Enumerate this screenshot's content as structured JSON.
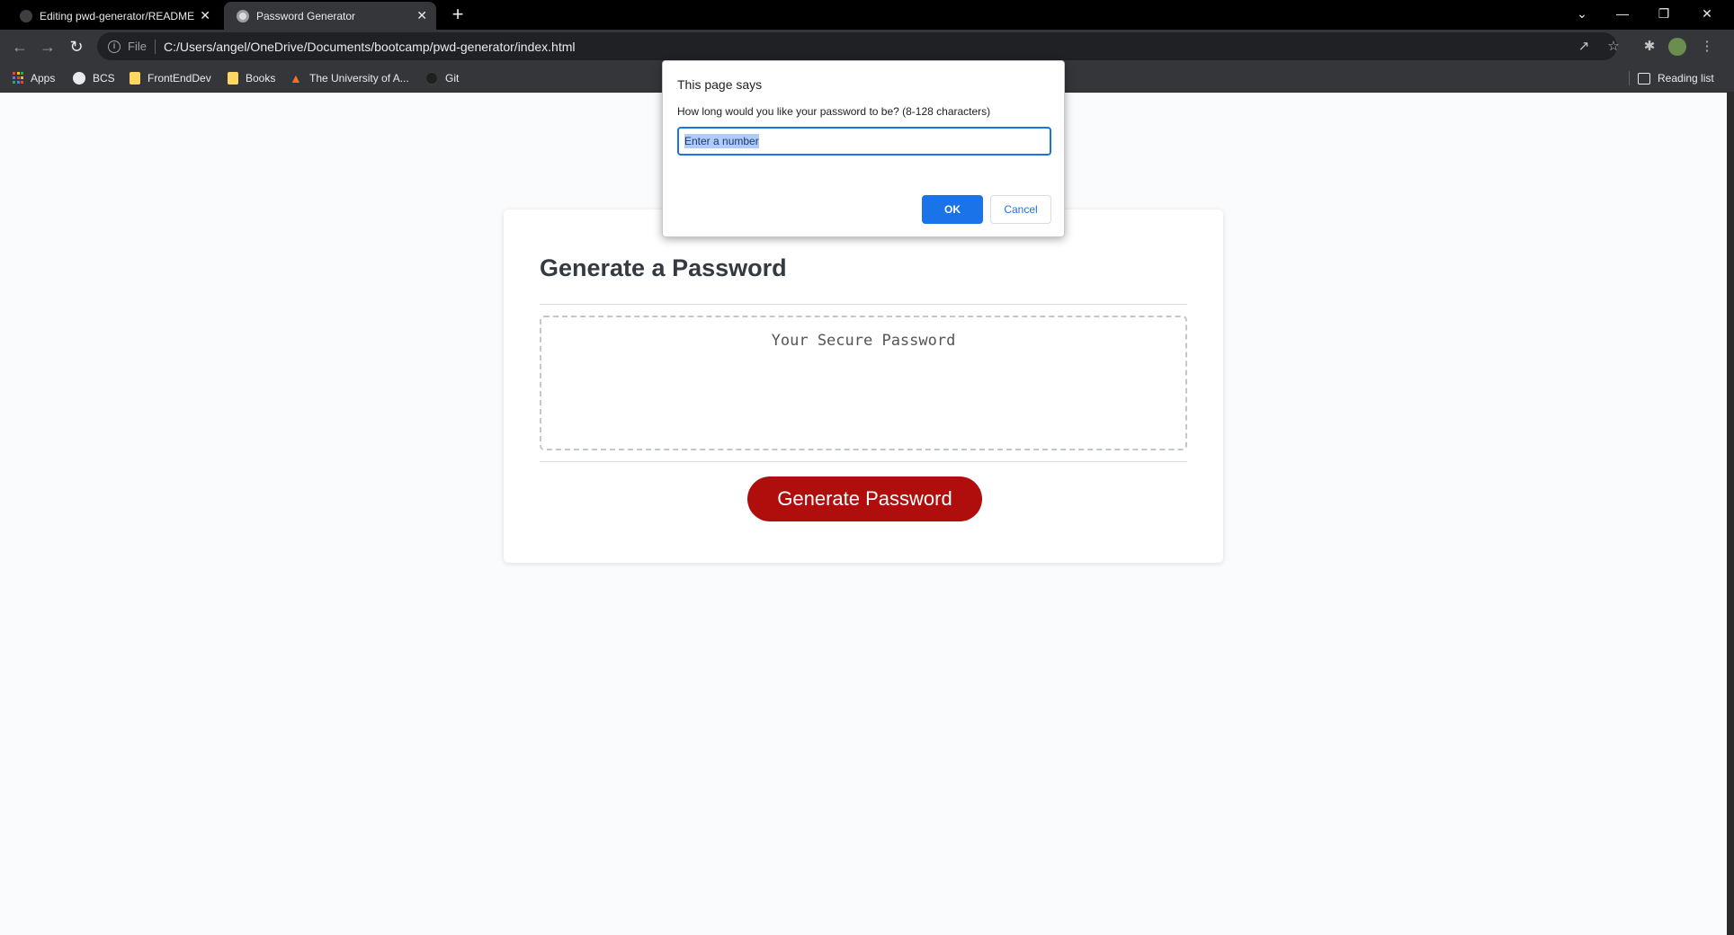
{
  "tabs": [
    {
      "title": "Editing pwd-generator/README",
      "close": "✕"
    },
    {
      "title": "Password Generator",
      "close": "✕"
    }
  ],
  "new_tab_label": "+",
  "window_controls": {
    "dropdown": "⌄",
    "minimize": "—",
    "restore": "❐",
    "close": "✕"
  },
  "address_bar": {
    "scheme": "File",
    "url": "C:/Users/angel/OneDrive/Documents/bootcamp/pwd-generator/index.html"
  },
  "bookmarks": [
    {
      "label": "Apps",
      "icon": "apps-grid-icon"
    },
    {
      "label": "BCS",
      "icon": "globe-icon"
    },
    {
      "label": "FrontEndDev",
      "icon": "folder-icon"
    },
    {
      "label": "Books",
      "icon": "folder-icon"
    },
    {
      "label": "The University of A...",
      "icon": "gitlab-icon"
    },
    {
      "label": "Git",
      "icon": "github-icon"
    }
  ],
  "reading_list_label": "Reading list",
  "page": {
    "title": "Generate a Password",
    "password_placeholder": "Your Secure Password",
    "generate_button": "Generate Password",
    "button_color": "#b00d0d"
  },
  "dialog": {
    "title": "This page says",
    "message": "How long would you like your password to be? (8-128 characters)",
    "input_value": "Enter a number",
    "ok_label": "OK",
    "cancel_label": "Cancel",
    "accent": "#1a73e8"
  }
}
